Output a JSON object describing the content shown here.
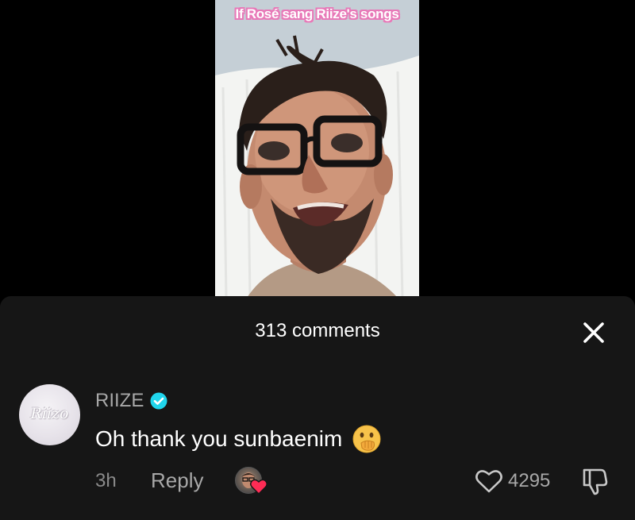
{
  "video": {
    "caption": "If Rosé sang Riize's songs"
  },
  "comments_sheet": {
    "count_label": "313 comments",
    "close_icon": "close-icon"
  },
  "comment": {
    "avatar_text": "Riizo",
    "username": "RIIZE",
    "verified_icon": "verified-badge-icon",
    "text": "Oh thank you sunbaenim",
    "emoji_icon": "face-with-open-eyes-and-hand-over-mouth-emoji",
    "time": "3h",
    "reply_label": "Reply",
    "creator_liked_icon": "creator-liked-heart-icon",
    "like_icon": "heart-outline-icon",
    "like_count": "4295",
    "dislike_icon": "thumbs-down-icon"
  },
  "colors": {
    "sheet_background": "#161616",
    "text_primary": "#ffffff",
    "text_secondary": "#a8a8a8",
    "verified_blue": "#20d5ec",
    "liked_red": "#fe2c55",
    "caption_outline": "#e879b8"
  }
}
